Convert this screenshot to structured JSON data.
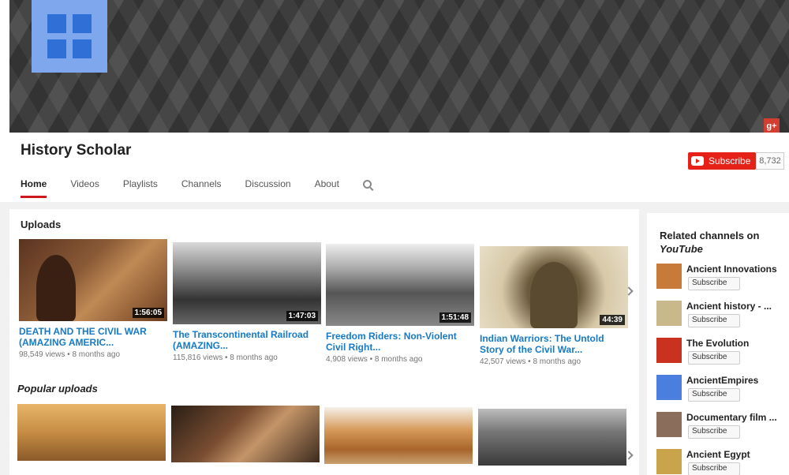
{
  "channel": {
    "name": "History Scholar",
    "subscribe_label": "Subscribe",
    "subscriber_count": "8,732",
    "gplus_label": "g+"
  },
  "tabs": [
    {
      "label": "Home",
      "active": true
    },
    {
      "label": "Videos"
    },
    {
      "label": "Playlists"
    },
    {
      "label": "Channels"
    },
    {
      "label": "Discussion"
    },
    {
      "label": "About"
    }
  ],
  "uploads": {
    "title": "Uploads",
    "videos": [
      {
        "title": "DEATH AND THE CIVIL WAR (AMAZING AMERIC...",
        "duration": "1:56:05",
        "views": "98,549 views",
        "age": "8 months ago"
      },
      {
        "title": "The Transcontinental Railroad (AMAZING...",
        "duration": "1:47:03",
        "views": "115,816 views",
        "age": "8 months ago"
      },
      {
        "title": "Freedom Riders: Non-Violent Civil Right...",
        "duration": "1:51:48",
        "views": "4,908 views",
        "age": "8 months ago"
      },
      {
        "title": "Indian Warriors: The Untold Story of the Civil War...",
        "duration": "44:39",
        "views": "42,507 views",
        "age": "8 months ago"
      }
    ]
  },
  "popular": {
    "title": "Popular uploads"
  },
  "related": {
    "title_line1": "Related channels on",
    "title_line2": "YouTube",
    "subscribe_label": "Subscribe",
    "channels": [
      {
        "name": "Ancient Innovations",
        "color": "#c87a3a"
      },
      {
        "name": "Ancient history - ...",
        "color": "#c9b98a"
      },
      {
        "name": "The Evolution",
        "color": "#c8321e"
      },
      {
        "name": "AncientEmpires",
        "color": "#4a7fe0"
      },
      {
        "name": "Documentary film ...",
        "color": "#8a6d5a"
      },
      {
        "name": "Ancient Egypt",
        "color": "#c9a44a"
      }
    ]
  },
  "colors": {
    "accent_red": "#e62117",
    "link_blue": "#167ac6"
  }
}
